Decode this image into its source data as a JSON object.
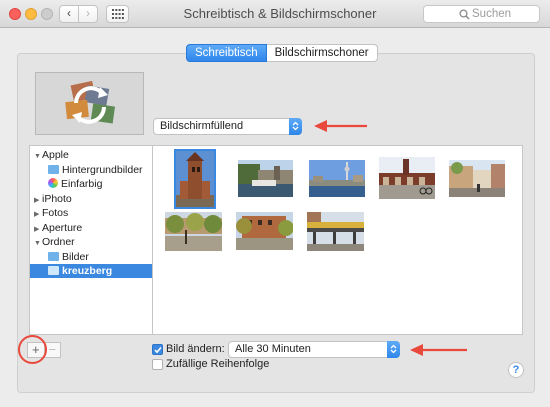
{
  "window": {
    "title": "Schreibtisch & Bildschirmschoner"
  },
  "toolbar": {
    "back_label": "‹",
    "forward_label": "›"
  },
  "search": {
    "placeholder": "Suchen",
    "value": ""
  },
  "tabs": [
    {
      "label": "Schreibtisch",
      "selected": true
    },
    {
      "label": "Bildschirmschoner",
      "selected": false
    }
  ],
  "fill_popup": {
    "value": "Bildschirmfüllend"
  },
  "sidebar": {
    "rows": [
      {
        "label": "Apple",
        "indent": 0,
        "disclosure": "▼",
        "icon": "",
        "selected": false
      },
      {
        "label": "Hintergrundbilder",
        "indent": 1,
        "disclosure": "",
        "icon": "folder-icon",
        "selected": false
      },
      {
        "label": "Einfarbig",
        "indent": 1,
        "disclosure": "",
        "icon": "color-wheel-icon",
        "selected": false
      },
      {
        "label": "iPhoto",
        "indent": 0,
        "disclosure": "▶",
        "icon": "",
        "selected": false
      },
      {
        "label": "Fotos",
        "indent": 0,
        "disclosure": "▶",
        "icon": "",
        "selected": false
      },
      {
        "label": "Aperture",
        "indent": 0,
        "disclosure": "▶",
        "icon": "",
        "selected": false
      },
      {
        "label": "Ordner",
        "indent": 0,
        "disclosure": "▼",
        "icon": "",
        "selected": false
      },
      {
        "label": "Bilder",
        "indent": 1,
        "disclosure": "",
        "icon": "folder-icon",
        "selected": false
      },
      {
        "label": "kreuzberg",
        "indent": 1,
        "disclosure": "",
        "icon": "folder-icon",
        "selected": true
      }
    ]
  },
  "photos": [
    {
      "subject": "brick-tower",
      "selected": true
    },
    {
      "subject": "river-boat",
      "selected": false
    },
    {
      "subject": "tv-tower-river",
      "selected": false
    },
    {
      "subject": "bridge-cyclist",
      "selected": false
    },
    {
      "subject": "street-facades",
      "selected": false
    },
    {
      "subject": "tree-lined-square",
      "selected": false
    },
    {
      "subject": "brick-building-trees",
      "selected": false
    },
    {
      "subject": "elevated-train",
      "selected": false
    }
  ],
  "bottom": {
    "plus_label": "+",
    "minus_label": "−",
    "change_picture": {
      "label": "Bild ändern:",
      "checked": true
    },
    "interval": {
      "value": "Alle 30 Minuten"
    },
    "random_order": {
      "label": "Zufällige Reihenfolge",
      "checked": false
    },
    "help_label": "?"
  },
  "colors": {
    "accent": "#3b88e0",
    "annotation": "#e8493c"
  }
}
